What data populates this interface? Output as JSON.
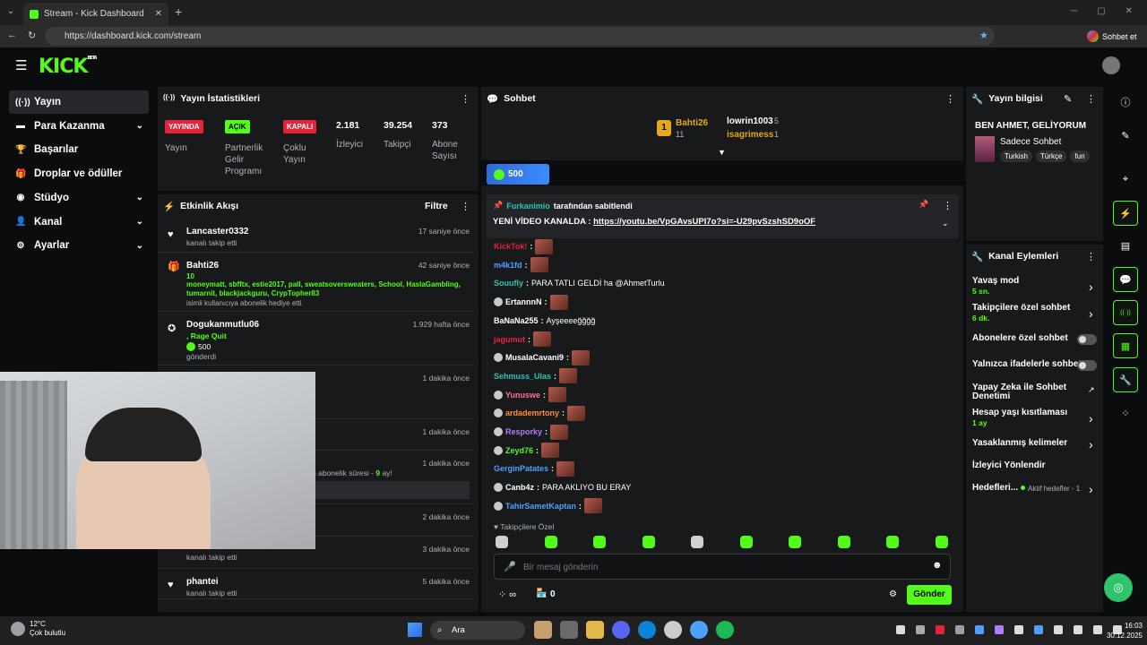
{
  "browser": {
    "tab_title": "Stream - Kick Dashboard",
    "url": "https://dashboard.kick.com/stream",
    "profile_label": "Sohbet et"
  },
  "app": {
    "logo": "KICK",
    "logo_tag": "BETA"
  },
  "sidebar": {
    "items": [
      {
        "label": "Yayın",
        "icon": "radio-icon"
      },
      {
        "label": "Para Kazanma",
        "icon": "money-icon"
      },
      {
        "label": "Başarılar",
        "icon": "trophy-icon"
      },
      {
        "label": "Droplar ve ödüller",
        "icon": "gift-icon"
      },
      {
        "label": "Stüdyo",
        "icon": "studio-icon"
      },
      {
        "label": "Kanal",
        "icon": "person-icon"
      },
      {
        "label": "Ayarlar",
        "icon": "gear-icon"
      }
    ]
  },
  "stats": {
    "title": "Yayın İstatistikleri",
    "badges": [
      {
        "badge": "YAYINDA",
        "label": "Yayın",
        "color": "#e5243b"
      },
      {
        "badge": "AÇIK",
        "label": "Partnerlik Gelir Programı",
        "color": "#53fc18"
      },
      {
        "badge": "KAPALI",
        "label": "Çoklu Yayın",
        "color": "#e5243b"
      }
    ],
    "numbers": [
      {
        "value": "2.181",
        "label": "İzleyici"
      },
      {
        "value": "39.254",
        "label": "Takipçi"
      },
      {
        "value": "373",
        "label": "Abone Sayısı"
      }
    ]
  },
  "activity": {
    "title": "Etkinlik Akışı",
    "filter": "Filtre",
    "events": [
      {
        "user": "Lancaster0332",
        "time": "17 saniye önce",
        "desc": "kanalı takip etti"
      },
      {
        "user": "Bahti26",
        "time": "42 saniye önce",
        "count": "10",
        "names": "moneymatt, sbfftx, estie2017, pall, sweatsoversweaters, School, HaslaGambling, tumarnit, blackjackguru, CrypTopher83",
        "desc": "isimli kullanıcıya abonelik hediye etti."
      },
      {
        "user": "Dogukanmutlu06",
        "time": "1.929 hafta önce",
        "extra": ", Rage Quit",
        "amount": "500",
        "desc": "gönderdi"
      },
      {
        "time": "1 dakika önce"
      },
      {
        "time": "1 dakika önce"
      },
      {
        "time": "1 dakika önce",
        "partial": "n abonelik süresi - ",
        "months": "9",
        "months_suffix": " ay!"
      },
      {
        "time": "2 dakika önce"
      },
      {
        "time": "3 dakika önce",
        "desc": "kanalı takip etti"
      },
      {
        "user": "phantei",
        "time": "5 dakika önce",
        "desc": "kanalı takip etti"
      }
    ]
  },
  "chat": {
    "title": "Sohbet",
    "leaders": [
      {
        "rank": "1",
        "user": "Bahti26",
        "count": "11"
      },
      {
        "user": "lowrin1003",
        "count": "5"
      },
      {
        "user": "isagrimess",
        "count": "1"
      }
    ],
    "kicks_total": "500",
    "pinned_by": "Furkanimio",
    "pinned_suffix": "tarafından sabitlendi",
    "pinned_text": "YENİ VİDEO KANALDA : ",
    "pinned_link": "https://youtu.be/VpGAvsUPI7o?si=-U29pvSzshSD9oOF",
    "messages": [
      {
        "user": "KickTok!",
        "color": "#e5243b",
        "text": ""
      },
      {
        "user": "m4k1fd",
        "color": "#4ea0ff",
        "text": ""
      },
      {
        "user": "Souufly",
        "color": "#2ec4b6",
        "text": "PARA TATLI GELDİ ha @AhmetTurlu"
      },
      {
        "user": "ErtannnN",
        "color": "#ffffff",
        "text": ""
      },
      {
        "user": "BaNaNa255",
        "color": "#ffffff",
        "text": "Ayşeeeeğğğğ"
      },
      {
        "user": "jagumut",
        "color": "#e5243b",
        "text": ""
      },
      {
        "user": "MusalaCavani9",
        "color": "#ffffff",
        "text": ""
      },
      {
        "user": "Sehmuss_Ulas",
        "color": "#2ec4b6",
        "text": ""
      },
      {
        "user": "Yunuswe",
        "color": "#ff6b9e",
        "text": ""
      },
      {
        "user": "ardademrtony",
        "color": "#ff8c3b",
        "text": ""
      },
      {
        "user": "Resporky",
        "color": "#b07cff",
        "text": ""
      },
      {
        "user": "Zeyd76",
        "color": "#53fc18",
        "text": ""
      },
      {
        "user": "GerginPatates",
        "color": "#4ea0ff",
        "text": ""
      },
      {
        "user": "Canb4z",
        "color": "#ffffff",
        "text": "PARA AKLIYO BU ERAY"
      },
      {
        "user": "TahirSametKaptan",
        "color": "#4ea0ff",
        "text": ""
      }
    ],
    "followers_only": "Takipçilere Özel",
    "input_placeholder": "Bir mesaj gönderin",
    "points": "0",
    "send": "Gönder"
  },
  "stream_info": {
    "title": "Yayın bilgisi",
    "stream_title": "BEN AHMET, GELİYORUM",
    "category": "Sadece Sohbet",
    "tags": [
      "Turkish",
      "Türkçe",
      "fun"
    ]
  },
  "channel_actions": {
    "title": "Kanal Eylemleri",
    "items": [
      {
        "label": "Yavaş mod",
        "sub": "5 sn."
      },
      {
        "label": "Takipçilere özel sohbet",
        "sub": "6 dk."
      },
      {
        "label": "Abonelere özel sohbet"
      },
      {
        "label": "Yalnızca ifadelerle sohbet"
      },
      {
        "label": "Yapay Zeka ile Sohbet Denetimi"
      },
      {
        "label": "Hesap yaşı kısıtlaması",
        "sub": "1 ay"
      },
      {
        "label": "Yasaklanmış kelimeler"
      },
      {
        "label": "İzleyici Yönlendir"
      },
      {
        "label": "Hedefleri...",
        "sub": "Aktif hedefler - 1"
      }
    ]
  },
  "taskbar": {
    "temp": "12°C",
    "weather": "Çok bulutlu",
    "search": "Ara",
    "time": "16:03",
    "date": "30.12.2025"
  },
  "colors": {
    "accent": "#53fc18",
    "live": "#e5243b",
    "panel": "#18191b"
  }
}
